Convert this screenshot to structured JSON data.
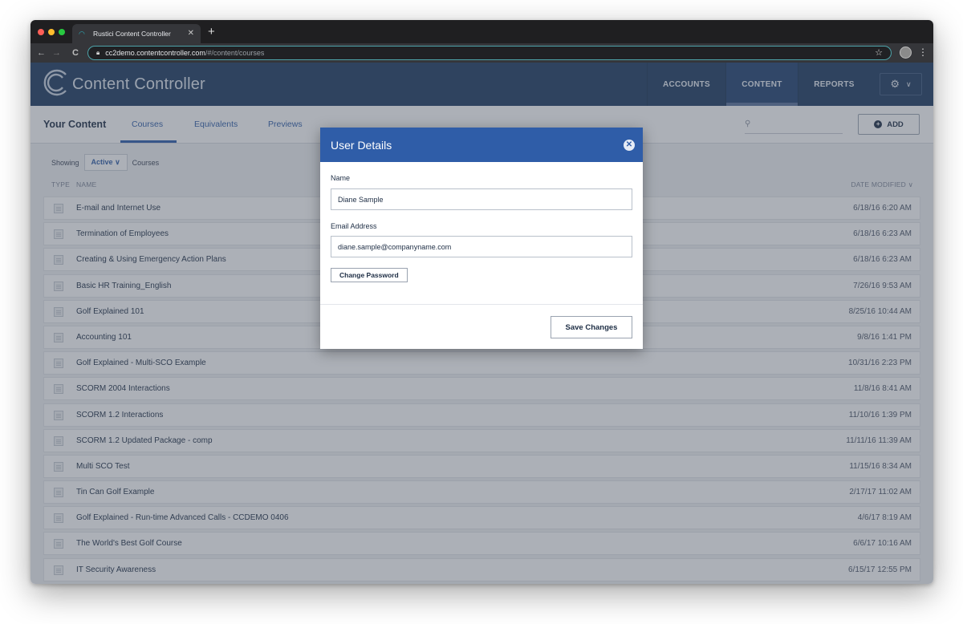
{
  "browser": {
    "tab_title": "Rustici Content Controller",
    "url_host": "cc2demo.contentcontroller.com",
    "url_path": "/#/content/courses"
  },
  "header": {
    "brand": "Content Controller",
    "nav": [
      "ACCOUNTS",
      "CONTENT",
      "REPORTS"
    ],
    "active_nav": "CONTENT"
  },
  "subnav": {
    "title": "Your Content",
    "tabs": [
      "Courses",
      "Equivalents",
      "Previews"
    ],
    "active_tab": "Courses",
    "add_label": "ADD",
    "search_placeholder": ""
  },
  "filter": {
    "prefix": "Showing",
    "selected": "Active",
    "suffix": "Courses"
  },
  "table": {
    "columns": {
      "type": "TYPE",
      "name": "NAME",
      "date": "DATE MODIFIED"
    },
    "rows": [
      {
        "name": "E-mail and Internet Use",
        "date": "6/18/16 6:20 AM"
      },
      {
        "name": "Termination of Employees",
        "date": "6/18/16 6:23 AM"
      },
      {
        "name": "Creating & Using Emergency Action Plans",
        "date": "6/18/16 6:23 AM"
      },
      {
        "name": "Basic HR Training_English",
        "date": "7/26/16 9:53 AM"
      },
      {
        "name": "Golf Explained 101",
        "date": "8/25/16 10:44 AM"
      },
      {
        "name": "Accounting 101",
        "date": "9/8/16 1:41 PM"
      },
      {
        "name": "Golf Explained - Multi-SCO Example",
        "date": "10/31/16 2:23 PM"
      },
      {
        "name": "SCORM 2004 Interactions",
        "date": "11/8/16 8:41 AM"
      },
      {
        "name": "SCORM 1.2 Interactions",
        "date": "11/10/16 1:39 PM"
      },
      {
        "name": "SCORM 1.2 Updated Package - comp",
        "date": "11/11/16 11:39 AM"
      },
      {
        "name": "Multi SCO Test",
        "date": "11/15/16 8:34 AM"
      },
      {
        "name": "Tin Can Golf Example",
        "date": "2/17/17 11:02 AM"
      },
      {
        "name": "Golf Explained - Run-time Advanced Calls - CCDEMO 0406",
        "date": "4/6/17 8:19 AM"
      },
      {
        "name": "The World's Best Golf Course",
        "date": "6/6/17 10:16 AM"
      },
      {
        "name": "IT Security Awareness",
        "date": "6/15/17 12:55 PM"
      }
    ]
  },
  "modal": {
    "title": "User Details",
    "name_label": "Name",
    "name_value": "Diane Sample",
    "email_label": "Email Address",
    "email_value": "diane.sample@companyname.com",
    "change_password_label": "Change Password",
    "save_label": "Save Changes"
  },
  "colors": {
    "header_bg": "#1c3a5f",
    "accent_blue": "#2f5da8"
  }
}
